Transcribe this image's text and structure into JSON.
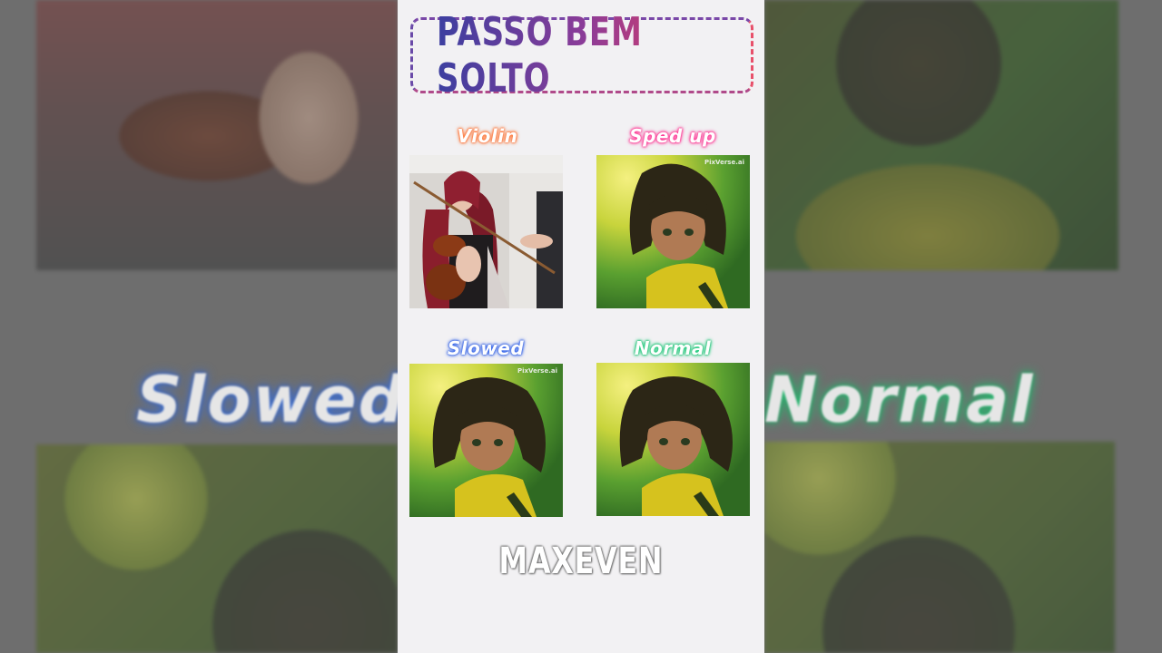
{
  "title": "PASSO BEM SOLTO",
  "cells": {
    "violin": {
      "label": "Violin"
    },
    "sped_up": {
      "label": "Sped up",
      "watermark": "PixVerse.ai"
    },
    "slowed": {
      "label": "Slowed",
      "watermark": "PixVerse.ai"
    },
    "normal": {
      "label": "Normal"
    }
  },
  "author": "MAXEVEN",
  "background_labels": {
    "left": "Slowed",
    "right": "Normal"
  },
  "colors": {
    "title_gradient": [
      "#3c3fa0",
      "#8a3c98",
      "#ee3d5c"
    ],
    "violin_glow": "#ff7a3a",
    "sped_glow": "#ff3a9a",
    "slowed_glow": "#3a6af0",
    "normal_glow": "#20d080",
    "panel_bg": "#f2f1f3"
  },
  "icons": [
    "violin-photo",
    "anime-girl-illustration"
  ]
}
